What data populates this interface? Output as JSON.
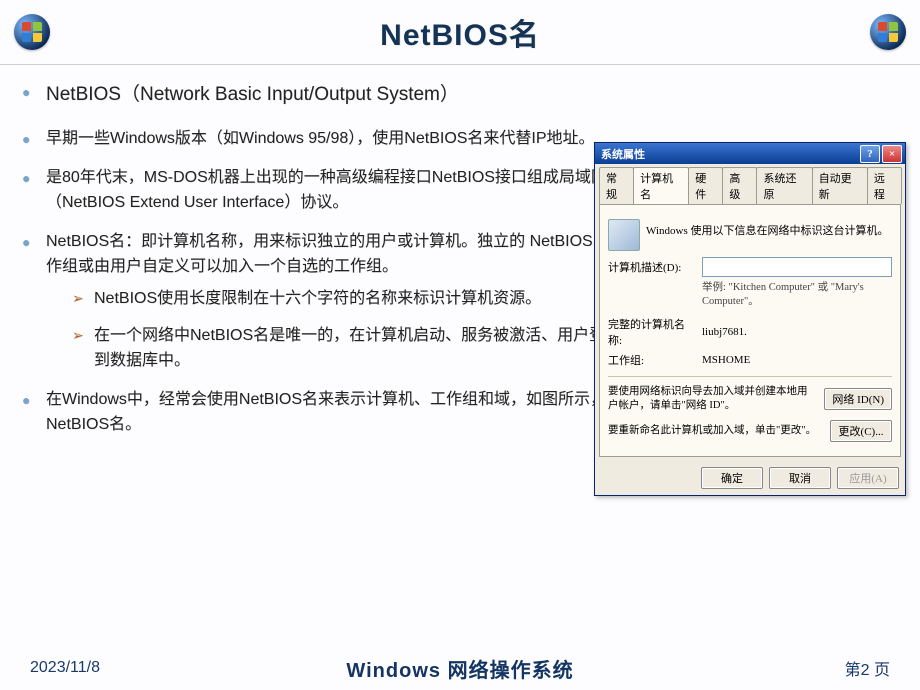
{
  "header": {
    "title": "NetBIOS名"
  },
  "bullets": [
    {
      "text": "NetBIOS（Network Basic Input/Output System）",
      "class": "first"
    },
    {
      "text": "早期一些Windows版本（如Windows 95/98），使用NetBIOS名来代替IP地址。"
    },
    {
      "text": "是80年代末，MS-DOS机器上出现的一种高级编程接口NetBIOS接口组成局域网，微软对它进行了扩展，成为NetBEUI（NetBIOS Extend User Interface）协议。"
    },
    {
      "text": "NetBIOS名：即计算机名称，用来标识独立的用户或计算机。独立的 NetBIOS 名是工作组的成员，它们属于一个默认的工作组或由用户自定义可以加入一个自选的工作组。",
      "sub": [
        "NetBIOS使用长度限制在十六个字符的名称来标识计算机资源。",
        "在一个网络中NetBIOS名是唯一的，在计算机启动、服务被激活、用户登录到网络时，NetBIOS名将被动态的注册到数据库中。"
      ]
    },
    {
      "text": "在Windows中，经常会使用NetBIOS名来表示计算机、工作组和域，如图所示，就是计算机的NetBIOS名和工作组的NetBIOS名。"
    }
  ],
  "dialog": {
    "title": "系统属性",
    "tabs": [
      "常规",
      "计算机名",
      "硬件",
      "高级",
      "系统还原",
      "自动更新",
      "远程"
    ],
    "active_tab": 1,
    "intro": "Windows 使用以下信息在网络中标识这台计算机。",
    "desc_label": "计算机描述(D):",
    "desc_value": "",
    "desc_hint": "举例: \"Kitchen Computer\" 或 \"Mary's Computer\"。",
    "fullname_label": "完整的计算机名称:",
    "fullname_value": "liubj7681.",
    "workgroup_label": "工作组:",
    "workgroup_value": "MSHOME",
    "netid_text": "要使用网络标识向导去加入域并创建本地用户帐户，请单击\"网络 ID\"。",
    "netid_btn": "网络 ID(N)",
    "change_text": "要重新命名此计算机或加入域，单击\"更改\"。",
    "change_btn": "更改(C)...",
    "ok": "确定",
    "cancel": "取消",
    "apply": "应用(A)"
  },
  "footer": {
    "date": "2023/11/8",
    "title": "Windows 网络操作系统",
    "page": "第2 页"
  }
}
